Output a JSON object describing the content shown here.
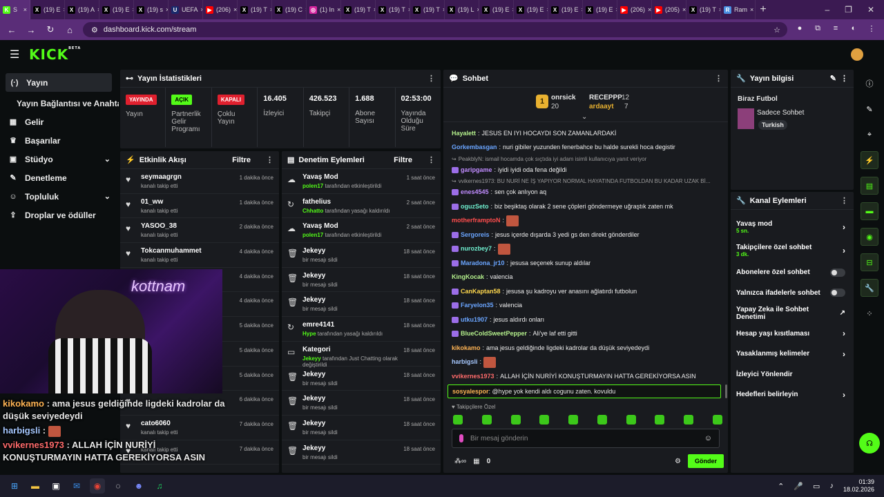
{
  "browser": {
    "tabs": [
      {
        "icon": "K",
        "color": "#53fc18",
        "label": "S"
      },
      {
        "icon": "X",
        "color": "#000",
        "label": "(19) E"
      },
      {
        "icon": "X",
        "color": "#000",
        "label": "(19) A"
      },
      {
        "icon": "X",
        "color": "#000",
        "label": "(19) E"
      },
      {
        "icon": "X",
        "color": "#000",
        "label": "(19) s"
      },
      {
        "icon": "U",
        "color": "#1a2a6c",
        "label": "UEFA"
      },
      {
        "icon": "▶",
        "color": "#f00",
        "label": "(206)"
      },
      {
        "icon": "X",
        "color": "#000",
        "label": "(19) T"
      },
      {
        "icon": "X",
        "color": "#000",
        "label": "(19) C"
      },
      {
        "icon": "◎",
        "color": "#d6249f",
        "label": "(1) In"
      },
      {
        "icon": "X",
        "color": "#000",
        "label": "(19) T"
      },
      {
        "icon": "X",
        "color": "#000",
        "label": "(19) T"
      },
      {
        "icon": "X",
        "color": "#000",
        "label": "(19) T"
      },
      {
        "icon": "X",
        "color": "#000",
        "label": "(19) L"
      },
      {
        "icon": "X",
        "color": "#000",
        "label": "(19) E"
      },
      {
        "icon": "X",
        "color": "#000",
        "label": "(19) E"
      },
      {
        "icon": "X",
        "color": "#000",
        "label": "(19) E"
      },
      {
        "icon": "X",
        "color": "#000",
        "label": "(19) E"
      },
      {
        "icon": "▶",
        "color": "#f00",
        "label": "(206)"
      },
      {
        "icon": "▶",
        "color": "#f00",
        "label": "(205)"
      },
      {
        "icon": "X",
        "color": "#000",
        "label": "(19) T"
      },
      {
        "icon": "R",
        "color": "#4a90e2",
        "label": "Ram"
      }
    ],
    "url": "dashboard.kick.com/stream"
  },
  "sidebar": {
    "items": [
      {
        "icon": "(·)",
        "label": "Yayın",
        "active": true
      },
      {
        "sub": true,
        "label": "Yayın Bağlantısı ve Anahtarı"
      },
      {
        "icon": "▦",
        "label": "Gelir"
      },
      {
        "icon": "♛",
        "label": "Başarılar"
      },
      {
        "icon": "▣",
        "label": "Stüdyo",
        "chev": true
      },
      {
        "icon": "✎",
        "label": "Denetleme"
      },
      {
        "icon": "☺",
        "label": "Topluluk",
        "chev": true
      },
      {
        "icon": "⇪",
        "label": "Droplar ve ödüller"
      }
    ]
  },
  "stats": {
    "title": "Yayın İstatistikleri",
    "cols": [
      {
        "badge": "YAYINDA",
        "badge_color": "#e0202e",
        "label": "Yayın"
      },
      {
        "badge": "AÇIK",
        "badge_color": "#53fc18",
        "label": "Partnerlik Gelir Programı"
      },
      {
        "badge": "KAPALI",
        "badge_color": "#e0202e",
        "label": "Çoklu Yayın"
      },
      {
        "value": "16.405",
        "label": "İzleyici"
      },
      {
        "value": "426.523",
        "label": "Takipçi"
      },
      {
        "value": "1.688",
        "label": "Abone Sayısı"
      },
      {
        "value": "02:53:00",
        "label": "Yayında Olduğu Süre"
      }
    ]
  },
  "activity": {
    "title": "Etkinlik Akışı",
    "filter": "Filtre",
    "rows": [
      {
        "name": "seymaagrgn",
        "sub": "kanalı takip etti",
        "time": "1 dakika önce"
      },
      {
        "name": "01_ww",
        "sub": "kanalı takip etti",
        "time": "1 dakika önce"
      },
      {
        "name": "YASOO_38",
        "sub": "kanalı takip etti",
        "time": "2 dakika önce"
      },
      {
        "name": "Tokcanmuhammet",
        "sub": "kanalı takip etti",
        "time": "4 dakika önce"
      },
      {
        "name": "",
        "sub": "",
        "time": "4 dakika önce"
      },
      {
        "name": "",
        "sub": "",
        "time": "4 dakika önce"
      },
      {
        "name": "",
        "sub": "",
        "time": "5 dakika önce"
      },
      {
        "name": "",
        "sub": "",
        "time": "5 dakika önce"
      },
      {
        "name": "",
        "sub": "",
        "time": "5 dakika önce"
      },
      {
        "name": "",
        "sub": "",
        "time": "6 dakika önce"
      },
      {
        "name": "cato6060",
        "sub": "kanalı takip etti",
        "time": "7 dakika önce"
      },
      {
        "name": "",
        "sub": "kanalı takip etti",
        "time": "7 dakika önce"
      }
    ]
  },
  "moderation": {
    "title": "Denetim Eylemleri",
    "filter": "Filtre",
    "rows": [
      {
        "icon": "☁",
        "name": "Yavaş Mod",
        "actor": "polen17",
        "sub": "tarafından etkinleştirildi",
        "time": "1 saat önce"
      },
      {
        "icon": "↻",
        "name": "fathelius",
        "actor": "Chhatto",
        "sub": "tarafından yasağı kaldırıldı",
        "time": "2 saat önce"
      },
      {
        "icon": "☁",
        "name": "Yavaş Mod",
        "actor": "polen17",
        "sub": "tarafından etkinleştirildi",
        "time": "2 saat önce"
      },
      {
        "icon": "🗑",
        "name": "Jekeyy",
        "actor": "",
        "sub": "bir mesajı sildi",
        "time": "18 saat önce"
      },
      {
        "icon": "🗑",
        "name": "Jekeyy",
        "actor": "",
        "sub": "bir mesajı sildi",
        "time": "18 saat önce"
      },
      {
        "icon": "🗑",
        "name": "Jekeyy",
        "actor": "",
        "sub": "bir mesajı sildi",
        "time": "18 saat önce"
      },
      {
        "icon": "↻",
        "name": "emre4141",
        "actor": "Hype",
        "sub": "tarafından yasağı kaldırıldı",
        "time": "18 saat önce"
      },
      {
        "icon": "▭",
        "name": "Kategori",
        "actor": "Jekeyy",
        "sub": "tarafından Just Chatting olarak değiştirildi",
        "time": "18 saat önce"
      },
      {
        "icon": "🗑",
        "name": "Jekeyy",
        "actor": "",
        "sub": "bir mesajı sildi",
        "time": "18 saat önce"
      },
      {
        "icon": "🗑",
        "name": "Jekeyy",
        "actor": "",
        "sub": "bir mesajı sildi",
        "time": "18 saat önce"
      },
      {
        "icon": "🗑",
        "name": "Jekeyy",
        "actor": "",
        "sub": "bir mesajı sildi",
        "time": "18 saat önce"
      },
      {
        "icon": "🗑",
        "name": "Jekeyy",
        "actor": "",
        "sub": "bir mesajı sildi",
        "time": "18 saat önce"
      }
    ]
  },
  "chat": {
    "title": "Sohbet",
    "leaders": [
      {
        "name": "onrsick",
        "count": "20"
      },
      {
        "name": "RECEPPP",
        "count": "12"
      },
      {
        "name": "ardaayt",
        "count": "7"
      }
    ],
    "messages": [
      {
        "user": "Hayalett",
        "color": "#b4f08c",
        "text": "JESUS EN IYI HOCAYDI SON ZAMANLARDAKİ"
      },
      {
        "user": "Gorkembasgan",
        "color": "#6aa5ff",
        "text": "nuri gibiler yuzunden fenerbahce bu halde surekli hoca degistir"
      },
      {
        "reply": "PeakblyN: ismail hocamda çok sıçtıda iyi adam isimli kullanıcıya yanıt veriyor"
      },
      {
        "user": "garipgame",
        "color": "#c08cff",
        "text": "iyidi iyidi oda fena değildi",
        "badge": true
      },
      {
        "reply": "vvikernes1973: BU NURİ NE İŞ YAPIYOR NORMAL HAYATINDA FUTBOLDAN BU KADAR UZAK Bİ..."
      },
      {
        "user": "enes4545",
        "color": "#c08cff",
        "text": "sen çok anlıyon aq",
        "badge": true
      },
      {
        "user": "oguzSeto",
        "color": "#6ff0d0",
        "text": "biz beşiktaş olarak 2 sene çöpleri göndermeye uğraştık zaten mk",
        "badge": true
      },
      {
        "user": "motherframptoN",
        "color": "#ff4d4d",
        "text": "",
        "emote": true
      },
      {
        "user": "Sergoreis",
        "color": "#6aa5ff",
        "text": "jesus içerde dışarda 3 yedi gs den direkt gönderdiler",
        "badge": true
      },
      {
        "user": "nurozbey7",
        "color": "#6ff0d0",
        "text": "",
        "emote": true,
        "badge": true
      },
      {
        "user": "Maradona_jr10",
        "color": "#6aa5ff",
        "text": "jesusa seçenek sunup aldılar",
        "badge": true
      },
      {
        "user": "KingKocak",
        "color": "#b4f08c",
        "text": "valencia"
      },
      {
        "user": "CanKaptan58",
        "color": "#ffd84d",
        "text": "jesusa şu kadroyu ver anasını ağlatırdı futbolun",
        "badge": true
      },
      {
        "user": "Faryelon35",
        "color": "#6aa5ff",
        "text": "valencia",
        "badge": true
      },
      {
        "user": "utku1907",
        "color": "#6aa5ff",
        "text": "jesus aldırdı onları",
        "badge": true
      },
      {
        "user": "BlueColdSweetPepper",
        "color": "#b4f08c",
        "text": "Ali'ye laf etti gitti",
        "badge": true
      },
      {
        "user": "kikokamo",
        "color": "#ffb454",
        "text": "ama jesus geldiğinde ligdeki kadrolar da düşük seviyedeydi"
      },
      {
        "user": "harbigsli",
        "color": "#a6c8ff",
        "text": "",
        "emote": true
      },
      {
        "user": "vvikernes1973",
        "color": "#ff6b6b",
        "text": "ALLAH İÇİN NURİYİ KONUŞTURMAYIN HATTA GEREKİYORSA ASIN"
      }
    ],
    "pinned": {
      "user": "sosyalespor",
      "text": "@hype yok kendi aldı cogunu zaten. kovuldu"
    },
    "followers_only": "Takipçilere Özel",
    "placeholder": "Bir mesaj gönderin",
    "send": "Gönder",
    "points": "0"
  },
  "stream_info": {
    "title": "Yayın bilgisi",
    "stream_title": "Biraz Futbol",
    "category": "Sadece Sohbet",
    "tag": "Turkish"
  },
  "channel_actions": {
    "title": "Kanal Eylemleri",
    "items": [
      {
        "label": "Yavaş mod",
        "sub": "5 sn.",
        "type": "chev"
      },
      {
        "label": "Takipçilere özel sohbet",
        "sub": "3 dk.",
        "type": "chev"
      },
      {
        "label": "Abonelere özel sohbet",
        "sub": "",
        "type": "toggle"
      },
      {
        "label": "Yalnızca ifadelerle sohbet",
        "sub": "",
        "type": "toggle"
      },
      {
        "label": "Yapay Zeka ile Sohbet Denetimi",
        "sub": "",
        "type": "ext"
      },
      {
        "label": "Hesap yaşı kısıtlaması",
        "sub": "",
        "type": "chev"
      },
      {
        "label": "Yasaklanmış kelimeler",
        "sub": "",
        "type": "chev"
      },
      {
        "label": "İzleyici Yönlendir",
        "sub": "",
        "type": "none"
      },
      {
        "label": "Hedefleri belirleyin",
        "sub": "",
        "type": "chev"
      }
    ]
  },
  "overlay": [
    {
      "user": "kikokamo",
      "color": "#ffb454",
      "text": " : ama jesus geldiğinde ligdeki kadrolar da düşük seviyedeydi"
    },
    {
      "user": "harbigsli",
      "color": "#a6c8ff",
      "text": " : "
    },
    {
      "user": "vvikernes1973",
      "color": "#ff6b6b",
      "text": " : ALLAH İÇİN NURİYİ KONUŞTURMAYIN HATTA GEREKİYORSA ASIN"
    }
  ],
  "webcam_neon": "kottnam",
  "taskbar": {
    "time": "01:39",
    "date": "18.02.2026"
  }
}
